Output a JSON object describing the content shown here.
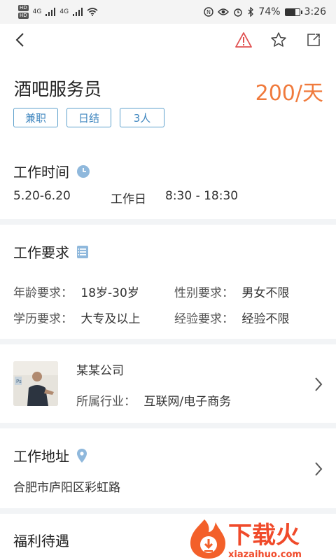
{
  "status_bar": {
    "left_badges": [
      "HD",
      "HD"
    ],
    "network": [
      "4G",
      "4G"
    ],
    "battery_percent": "74%",
    "battery_level": 0.74,
    "time": "3:26"
  },
  "nav": {
    "icons": [
      "back-arrow-icon",
      "warning-icon",
      "star-icon",
      "share-icon"
    ]
  },
  "job": {
    "title": "酒吧服务员",
    "salary": "200/天",
    "tags": [
      "兼职",
      "日结",
      "3人"
    ]
  },
  "work_time": {
    "heading": "工作时间",
    "date_range": "5.20-6.20",
    "days": "工作日",
    "hours": "8:30 - 18:30"
  },
  "requirements": {
    "heading": "工作要求",
    "items": [
      {
        "label": "年龄要求：",
        "value": "18岁-30岁"
      },
      {
        "label": "性别要求：",
        "value": "男女不限"
      },
      {
        "label": "学历要求：",
        "value": "大专及以上"
      },
      {
        "label": "经验要求：",
        "value": "经验不限"
      }
    ]
  },
  "company": {
    "name": "某某公司",
    "industry_label": "所属行业：",
    "industry_value": "互联网/电子商务"
  },
  "address": {
    "heading": "工作地址",
    "value": "合肥市庐阳区彩虹路"
  },
  "benefits": {
    "heading": "福利待遇"
  },
  "watermark": {
    "brand": "下载火",
    "url": "xiazaihuo.com"
  },
  "colors": {
    "accent_orange": "#f07a3c",
    "tag_blue": "#3f86bf",
    "icon_blue": "#8fb8dc",
    "warning_red": "#e05050"
  }
}
